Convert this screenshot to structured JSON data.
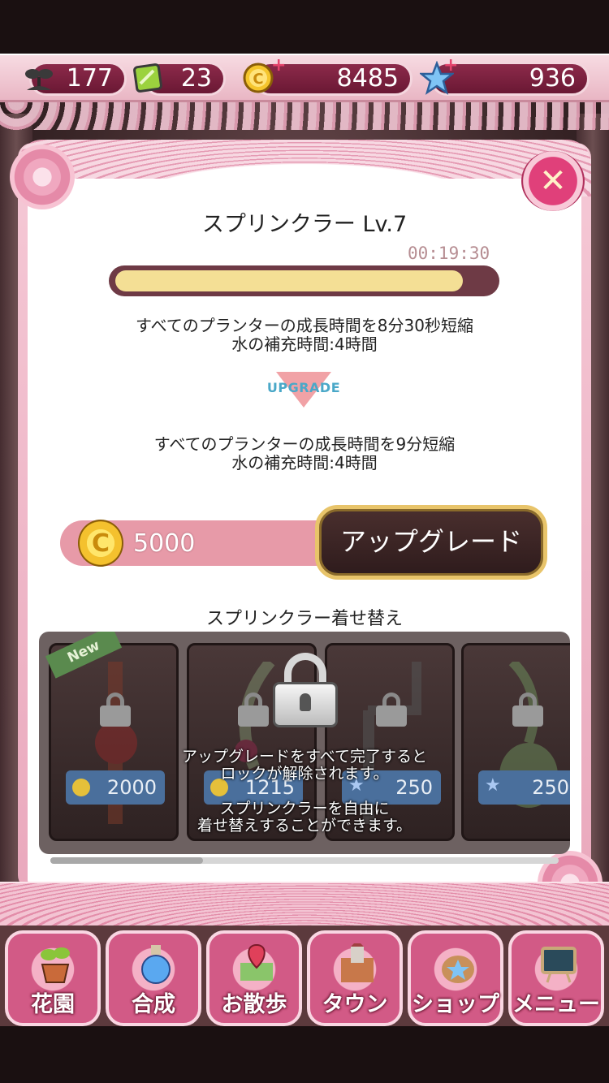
{
  "resources": {
    "seeds": "177",
    "tickets": "23",
    "coins": "8485",
    "stars": "936"
  },
  "modal": {
    "title": "スプリンクラー Lv.7",
    "timer": "00:19:30",
    "progress": 0.92,
    "current_effect": [
      "すべてのプランターの成長時間を8分30秒短縮",
      "水の補充時間:4時間"
    ],
    "upgrade_label": "UPGRADE",
    "next_effect": [
      "すべてのプランターの成長時間を9分短縮",
      "水の補充時間:4時間"
    ],
    "cost": "5000",
    "upgrade_button": "アップグレード",
    "close_icon": "close-icon"
  },
  "skins": {
    "title": "スプリンクラー着せ替え",
    "new_label": "New",
    "cards": [
      {
        "price": "2000",
        "currency": "coin"
      },
      {
        "price": "1215",
        "currency": "coin"
      },
      {
        "price": "250",
        "currency": "star"
      },
      {
        "price": "250",
        "currency": "star"
      }
    ],
    "lock_message": [
      "アップグレードをすべて完了すると",
      "ロックが解除されます。",
      "スプリンクラーを自由に",
      "着せ替えすることができます。"
    ]
  },
  "nav": {
    "items": [
      {
        "label": "花園",
        "icon": "flowerpot-icon"
      },
      {
        "label": "合成",
        "icon": "potion-icon"
      },
      {
        "label": "お散歩",
        "icon": "map-pin-icon"
      },
      {
        "label": "タウン",
        "icon": "castle-icon"
      },
      {
        "label": "ショップ",
        "icon": "bag-icon"
      },
      {
        "label": "メニュー",
        "icon": "menu-board-icon"
      }
    ]
  },
  "colors": {
    "accent_pink": "#e58aa8",
    "button_gold": "#e8c46a",
    "progress_fill": "#f4df95"
  }
}
